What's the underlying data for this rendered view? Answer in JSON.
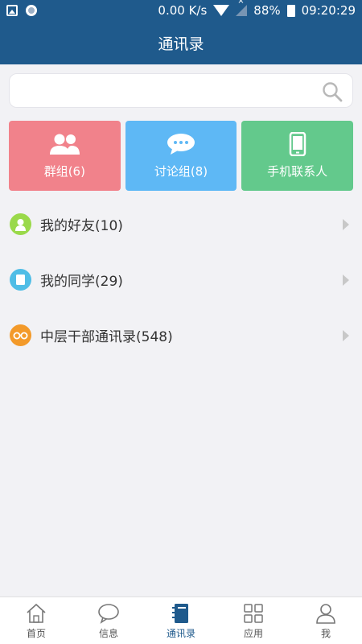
{
  "status_bar": {
    "speed": "0.00 K/s",
    "battery": "88%",
    "time": "09:20:29"
  },
  "header": {
    "title": "通讯录"
  },
  "search": {
    "placeholder": ""
  },
  "tiles": [
    {
      "label": "群组(6)",
      "color": "#f1828b",
      "icon": "group-icon"
    },
    {
      "label": "讨论组(8)",
      "color": "#5eb8f5",
      "icon": "chat-bubble-icon"
    },
    {
      "label": "手机联系人",
      "color": "#63c98c",
      "icon": "phone-icon"
    }
  ],
  "list": [
    {
      "label": "我的好友(10)",
      "icon": "friend-icon",
      "color": "#9ad94a"
    },
    {
      "label": "我的同学(29)",
      "icon": "classmate-icon",
      "color": "#4fbde6"
    },
    {
      "label": "中层干部通讯录(548)",
      "icon": "glasses-icon",
      "color": "#f39a2a"
    }
  ],
  "tabs": [
    {
      "label": "首页",
      "icon": "home-icon"
    },
    {
      "label": "信息",
      "icon": "message-icon"
    },
    {
      "label": "通讯录",
      "icon": "contacts-book-icon",
      "active": true
    },
    {
      "label": "应用",
      "icon": "apps-grid-icon"
    },
    {
      "label": "我",
      "icon": "user-icon"
    }
  ],
  "colors": {
    "primary": "#1f5a8c",
    "background": "#f2f2f5"
  }
}
